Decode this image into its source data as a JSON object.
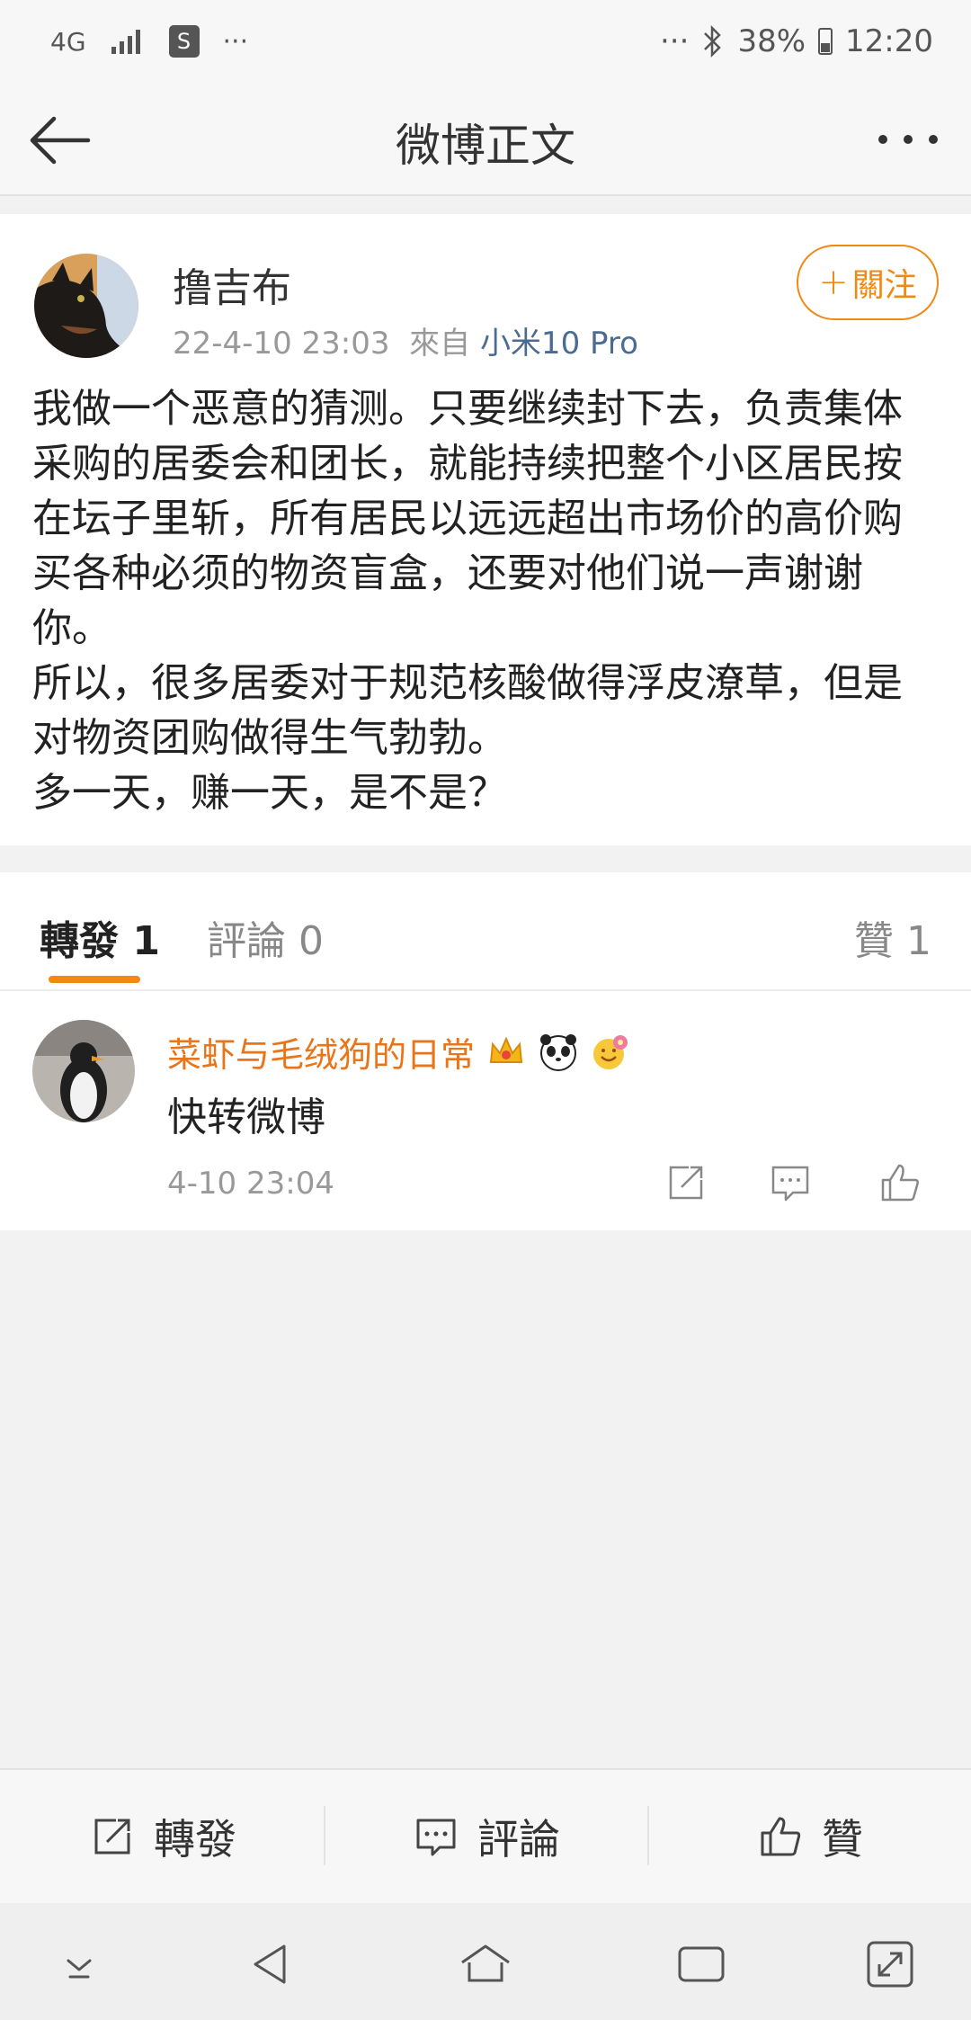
{
  "status_bar": {
    "network": "4G",
    "shop_badge": "S",
    "left_more": "···",
    "right_more": "···",
    "battery": "38%",
    "time": "12:20"
  },
  "header": {
    "title": "微博正文"
  },
  "post": {
    "author": "撸吉布",
    "timestamp": "22-4-10 23:03",
    "source_prefix": "來自",
    "source": "小米10 Pro",
    "follow_label": "關注",
    "paragraphs": [
      "我做一个恶意的猜测。只要继续封下去，负责集体采购的居委会和团长，就能持续把整个小区居民按在坛子里斩，所有居民以远远超出市场价的高价购买各种必须的物资盲盒，还要对他们说一声谢谢你。",
      "所以，很多居委对于规范核酸做得浮皮潦草，但是对物资团购做得生气勃勃。",
      "多一天，赚一天，是不是？"
    ]
  },
  "tabs": {
    "repost_label": "轉發",
    "repost_count": "1",
    "comment_label": "評論",
    "comment_count": "0",
    "like_label": "贊",
    "like_count": "1"
  },
  "reposts": [
    {
      "name": "菜虾与毛绒狗的日常",
      "text": "快转微博",
      "time": "4-10 23:04"
    }
  ],
  "action_bar": {
    "repost": "轉發",
    "comment": "評論",
    "like": "贊"
  },
  "colors": {
    "accent": "#f08a14",
    "link": "#4a6c93",
    "repost_name": "#e8751a"
  }
}
